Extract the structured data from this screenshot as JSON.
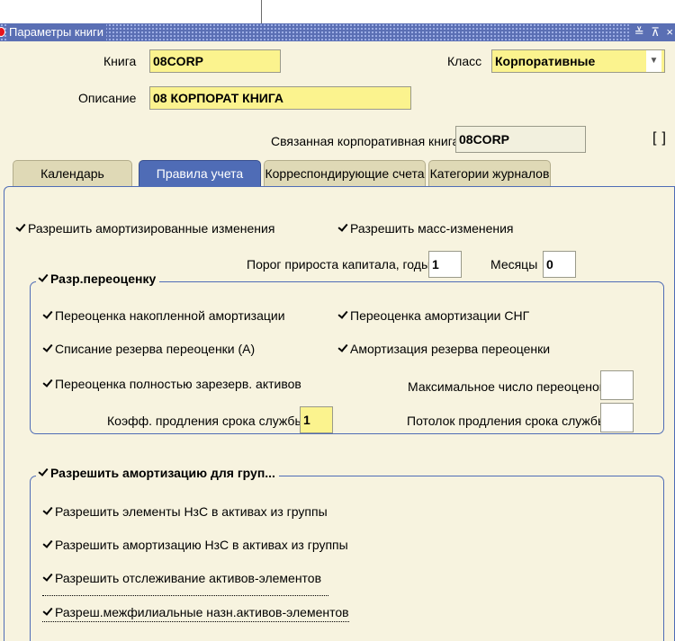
{
  "window": {
    "title": "Параметры книги",
    "controls": "≚ ⊼ ×"
  },
  "header": {
    "book_label": "Книга",
    "book_value": "08CORP",
    "class_label": "Класс",
    "class_value": "Корпоративные",
    "description_label": "Описание",
    "description_value": "08 КОРПОРАТ КНИГА",
    "linked_label": "Связанная корпоративная книга",
    "linked_value": "08CORP"
  },
  "tabs": [
    {
      "label": "Календарь",
      "active": false
    },
    {
      "label": "Правила учета",
      "active": true
    },
    {
      "label": "Корреспондирующие счета",
      "active": false
    },
    {
      "label": "Категории журналов",
      "active": false
    }
  ],
  "rules": {
    "allow_amortized_changes": "Разрешить амортизированные изменения",
    "allow_mass_changes": "Разрешить масс-изменения",
    "cap_gain_threshold_label": "Порог прироста капитала, годы",
    "cap_gain_threshold_years": "1",
    "months_label": "Месяцы",
    "months_value": "0"
  },
  "revaluation": {
    "title": "Разр.переоценку",
    "reval_accum_depr": "Переоценка накопленной амортизации",
    "reval_ytd_depr": "Переоценка амортизации СНГ",
    "retire_reval_reserve": "Списание резерва переоценки (A)",
    "amortize_reval_reserve": "Амортизация резерва переоценки",
    "reval_fully_reserved": "Переоценка полностью зарезерв. активов",
    "max_revaluations_label": "Максимальное число переоценок",
    "max_revaluations_value": "",
    "life_extension_factor_label": "Коэфф. продления срока службы",
    "life_extension_factor_value": "1",
    "life_extension_ceiling_label": "Потолок продления срока службы",
    "life_extension_ceiling_value": ""
  },
  "group_depr": {
    "title": "Разрешить амортизацию для груп...",
    "allow_cip_members": "Разрешить элементы НзС в активах из группы",
    "allow_cip_depr": "Разрешить амортизацию НзС в активах из группы",
    "allow_member_tracking": "Разрешить отслеживание активов-элементов",
    "allow_interco_member": "Разреш.межфилиальные назн.активов-элементов"
  }
}
